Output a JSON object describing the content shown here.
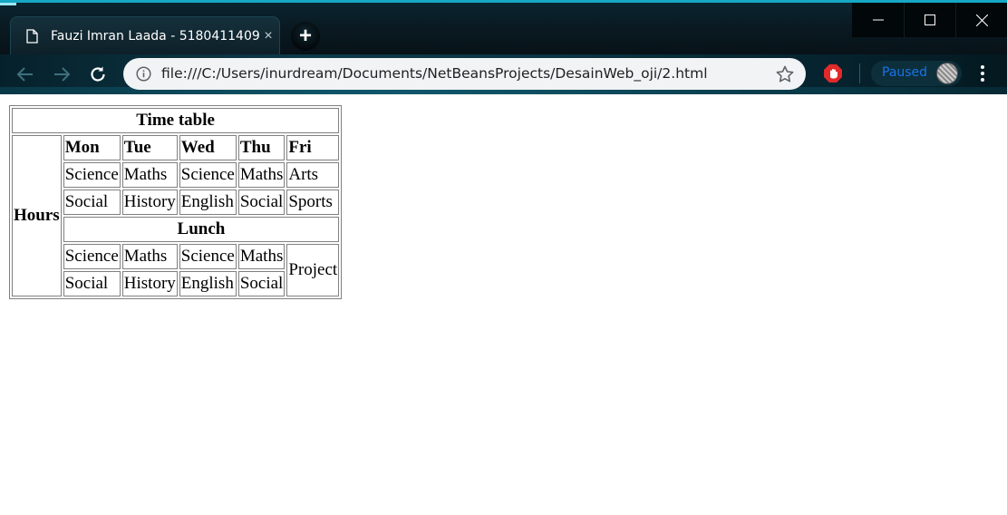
{
  "browser": {
    "tab_title": "Fauzi Imran Laada - 5180411409",
    "tab_close": "×",
    "new_tab": "+",
    "url": "file:///C:/Users/inurdream/Documents/NetBeansProjects/DesainWeb_oji/2.html",
    "profile_status": "Paused",
    "accent_color": "#16a8c4"
  },
  "timetable": {
    "caption": "Time table",
    "row_header": "Hours",
    "days": [
      "Mon",
      "Tue",
      "Wed",
      "Thu",
      "Fri"
    ],
    "morning_rows": [
      [
        "Science",
        "Maths",
        "Science",
        "Maths",
        "Arts"
      ],
      [
        "Social",
        "History",
        "English",
        "Social",
        "Sports"
      ]
    ],
    "break_label": "Lunch",
    "afternoon_rows": [
      [
        "Science",
        "Maths",
        "Science",
        "Maths"
      ],
      [
        "Social",
        "History",
        "English",
        "Social"
      ]
    ],
    "afternoon_friday": "Project"
  }
}
